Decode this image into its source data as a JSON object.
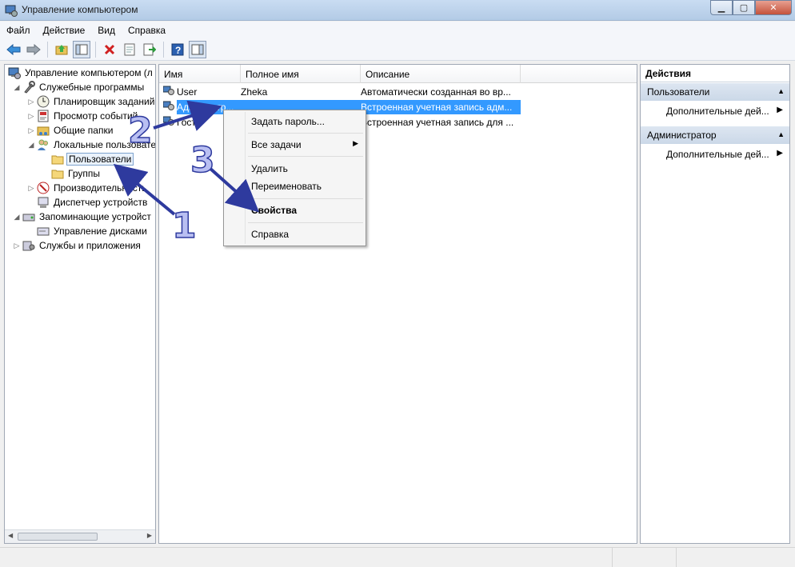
{
  "window": {
    "title": "Управление компьютером"
  },
  "menubar": [
    "Файл",
    "Действие",
    "Вид",
    "Справка"
  ],
  "tree": [
    {
      "label": "Управление компьютером (л",
      "icon": "computer-management-icon"
    },
    {
      "label": "Служебные программы",
      "icon": "tools-icon"
    },
    {
      "label": "Планировщик заданий",
      "icon": "clock-icon"
    },
    {
      "label": "Просмотр событий",
      "icon": "event-viewer-icon"
    },
    {
      "label": "Общие папки",
      "icon": "shared-folders-icon"
    },
    {
      "label": "Локальные пользовате",
      "icon": "users-icon"
    },
    {
      "label": "Пользователи",
      "icon": "folder-icon"
    },
    {
      "label": "Группы",
      "icon": "folder-icon"
    },
    {
      "label": "Производительность",
      "icon": "performance-icon"
    },
    {
      "label": "Диспетчер устройств",
      "icon": "device-manager-icon"
    },
    {
      "label": "Запоминающие устройст",
      "icon": "storage-icon"
    },
    {
      "label": "Управление дисками",
      "icon": "disk-icon"
    },
    {
      "label": "Службы и приложения",
      "icon": "services-icon"
    }
  ],
  "list": {
    "columns": [
      "Имя",
      "Полное имя",
      "Описание"
    ],
    "rows": [
      {
        "name": "User",
        "fullname": "Zheka",
        "description": "Автоматически созданная во вр..."
      },
      {
        "name": "Администр...",
        "fullname": "",
        "description": "Встроенная учетная запись адм..."
      },
      {
        "name": "Гость",
        "fullname": "",
        "description": "Встроенная учетная запись для ..."
      }
    ]
  },
  "actions": {
    "title": "Действия",
    "sections": [
      {
        "header": "Пользователи",
        "item": "Дополнительные дей..."
      },
      {
        "header": "Администратор",
        "item": "Дополнительные дей..."
      }
    ]
  },
  "context_menu": {
    "set_password": "Задать пароль...",
    "all_tasks": "Все задачи",
    "delete": "Удалить",
    "rename": "Переименовать",
    "properties": "Свойства",
    "help": "Справка"
  },
  "annotations": {
    "step1": "1",
    "step2": "2",
    "step3": "3",
    "color_fill": "#b9bff2",
    "color_stroke": "#2e3a9e"
  },
  "colors": {
    "selection": "#3399ff",
    "titlebar": "#c9dcf2"
  }
}
